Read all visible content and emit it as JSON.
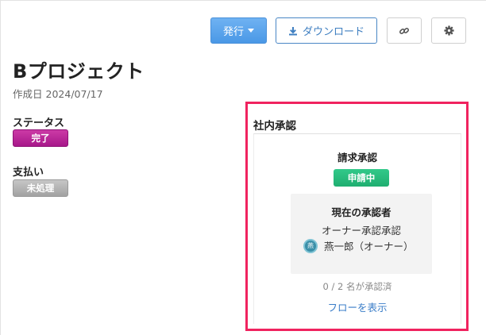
{
  "toolbar": {
    "issue_label": "発行",
    "download_label": "ダウンロード",
    "link_icon": "link-icon",
    "gear_icon": "gear-icon"
  },
  "header": {
    "title": "Bプロジェクト",
    "created_label": "作成日",
    "created_date": "2024/07/17"
  },
  "status": {
    "label": "ステータス",
    "value": "完了",
    "color": "#b61f95"
  },
  "payment": {
    "label": "支払い",
    "value": "未処理",
    "color": "#a9a9a9"
  },
  "approval": {
    "title": "社内承認",
    "request_title": "請求承認",
    "request_status": "申請中",
    "request_status_color": "#22b476",
    "approver_heading": "現在の承認者",
    "approver_role": "オーナー承認承認",
    "approver_avatar": "燕",
    "approver_name": "燕一郎（オーナー）",
    "count_text": "0 / 2 名が承認済",
    "flow_link": "フローを表示",
    "highlight_color": "#f0235f"
  }
}
